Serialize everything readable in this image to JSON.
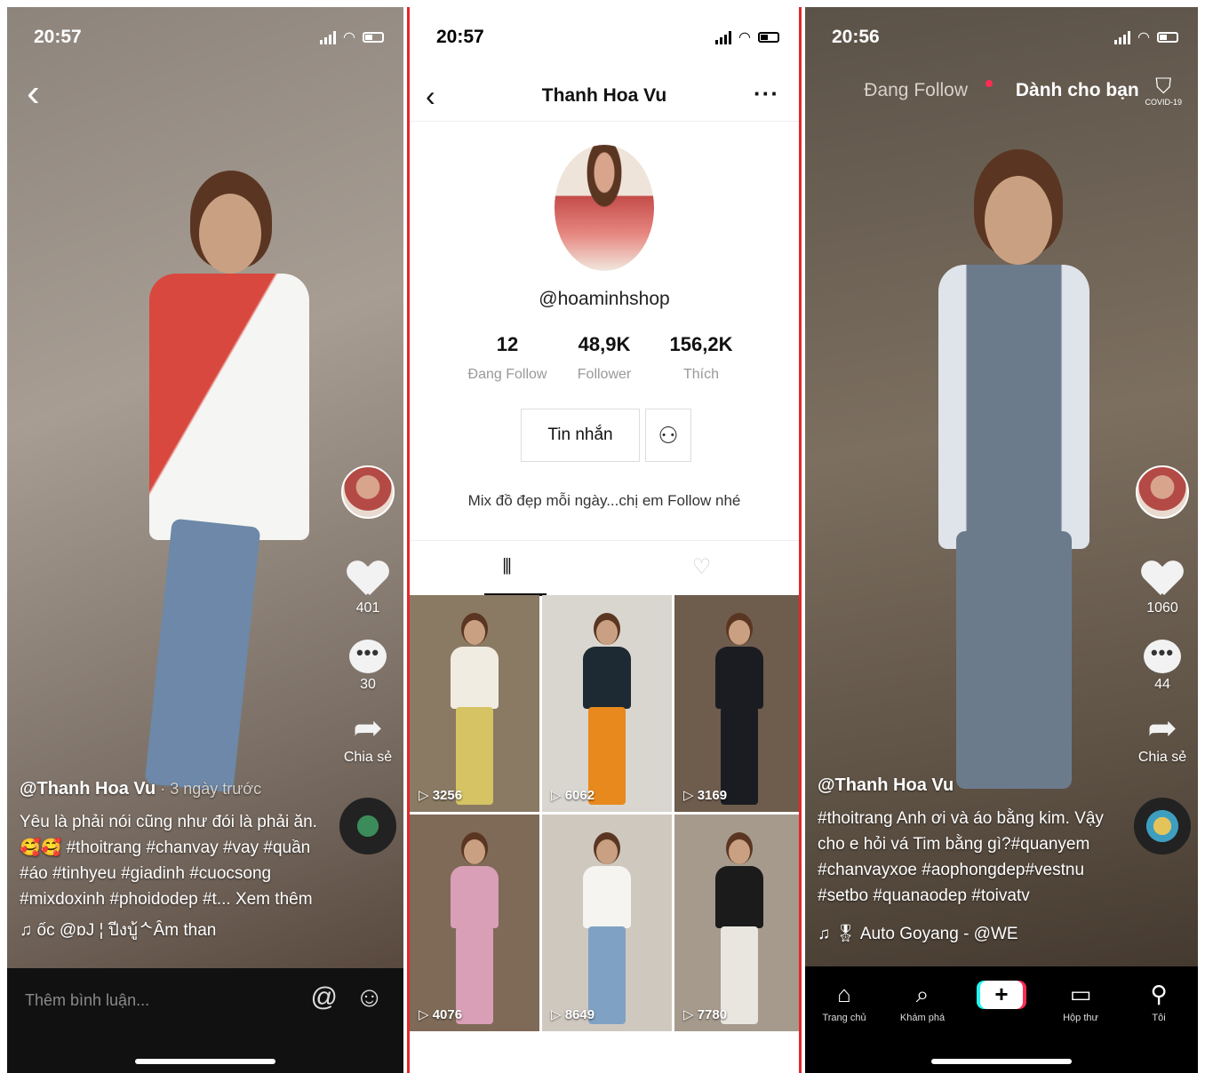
{
  "left": {
    "status_time": "20:57",
    "back": "‹",
    "likes": "401",
    "comments": "30",
    "share_label": "Chia sẻ",
    "username": "@Thanh Hoa Vu",
    "posted": " · 3 ngày trước",
    "caption_lines": [
      "Yêu là phải nói cũng như đói là phải ăn.",
      "🥰🥰 #thoitrang #chanvay #vay #quần",
      "#áo #tinhyeu #giadinh #cuocsong",
      "#mixdoxinh #phoidodep #t... Xem thêm"
    ],
    "music": "♫  ốc   @ɒJ ¦ ปีงบู้ᄾÂm than",
    "comment_placeholder": "Thêm bình luận...",
    "at_icon": "@",
    "emoji_icon": "☺"
  },
  "middle": {
    "status_time": "20:57",
    "back": "‹",
    "title": "Thanh Hoa Vu",
    "more": "···",
    "handle": "@hoaminhshop",
    "stats": [
      {
        "num": "12",
        "label": "Đang Follow"
      },
      {
        "num": "48,9K",
        "label": "Follower"
      },
      {
        "num": "156,2K",
        "label": "Thích"
      }
    ],
    "message_button": "Tin nhắn",
    "bio": "Mix đồ đẹp mỗi ngày...chị em Follow nhé",
    "videos": [
      {
        "views": "3256",
        "bg": "#8a7a63",
        "top": "#f1ece2",
        "bottom": "#d6c363"
      },
      {
        "views": "6062",
        "bg": "#d9d6d0",
        "top": "#1e2a33",
        "bottom": "#e8891d"
      },
      {
        "views": "3169",
        "bg": "#6e5c4d",
        "top": "#1a1c22",
        "bottom": "#1a1c22"
      },
      {
        "views": "4076",
        "bg": "#7f6a58",
        "top": "#d99fb6",
        "bottom": "#d99fb6"
      },
      {
        "views": "8649",
        "bg": "#cfc8bf",
        "top": "#f6f4f1",
        "bottom": "#7fa2c4"
      },
      {
        "views": "7780",
        "bg": "#a69a8d",
        "top": "#1b1b1b",
        "bottom": "#e9e6df"
      }
    ]
  },
  "right": {
    "status_time": "20:56",
    "tab_following": "Đang Follow",
    "tab_foryou": "Dành cho bạn",
    "covid_label": "COVID-19",
    "likes": "1060",
    "comments": "44",
    "share_label": "Chia sẻ",
    "username": "@Thanh Hoa Vu",
    "caption_lines": [
      "#thoitrang Anh ơi và áo bằng kim. Vậy",
      "cho e hỏi vá Tim bằng gì?#quanyem",
      "#chanvayxoe #aophongdep#vestnu",
      "#setbo #quanaodep #toivatv"
    ],
    "music": "♫  🎖  Auto Goyang - @WE",
    "nav": [
      {
        "icon": "⌂",
        "label": "Trang chủ"
      },
      {
        "icon": "⌕",
        "label": "Khám phá"
      },
      {
        "icon": "+",
        "label": ""
      },
      {
        "icon": "▭",
        "label": "Hộp thư"
      },
      {
        "icon": "⚲",
        "label": "Tôi"
      }
    ]
  }
}
